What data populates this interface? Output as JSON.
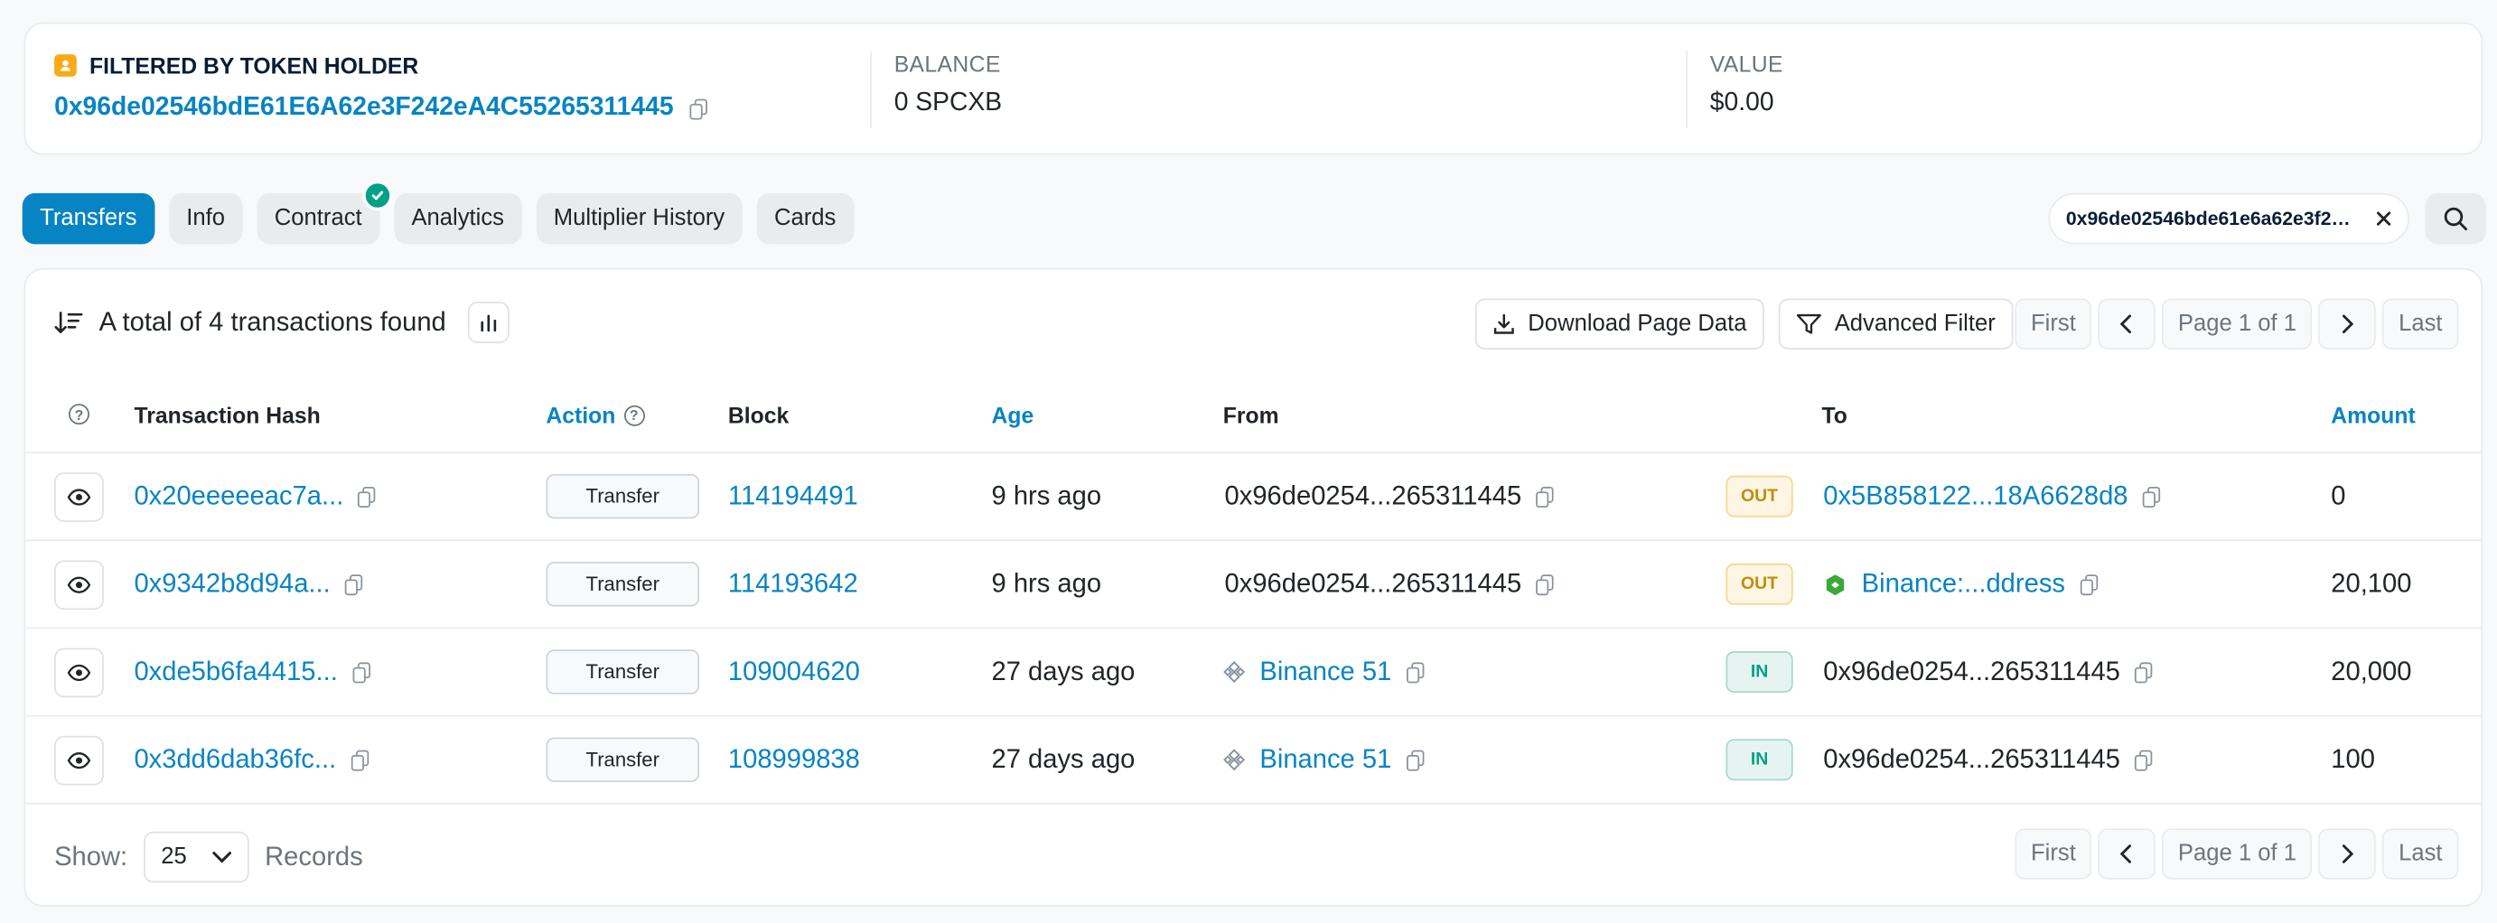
{
  "holder": {
    "title": "FILTERED BY TOKEN HOLDER",
    "address": "0x96de02546bdE61E6A62e3F242eA4C55265311445",
    "balance_label": "BALANCE",
    "balance_value": "0 SPCXB",
    "value_label": "VALUE",
    "value_value": "$0.00"
  },
  "tabs": [
    {
      "label": "Transfers",
      "active": true
    },
    {
      "label": "Info"
    },
    {
      "label": "Contract",
      "verified": true
    },
    {
      "label": "Analytics"
    },
    {
      "label": "Multiplier History"
    },
    {
      "label": "Cards"
    }
  ],
  "filter_chip": "0x96de02546bde61e6a62e3f242ea4c55265311445",
  "summary": "A total of 4 transactions found",
  "actions": {
    "download": "Download Page Data",
    "advanced_filter": "Advanced Filter"
  },
  "pager": {
    "first": "First",
    "page": "Page 1 of 1",
    "last": "Last"
  },
  "columns": {
    "hash": "Transaction Hash",
    "action": "Action",
    "block": "Block",
    "age": "Age",
    "from": "From",
    "to": "To",
    "amount": "Amount"
  },
  "rows": [
    {
      "hash": "0x20eeeeeac7a...",
      "method": "Transfer",
      "block": "114194491",
      "age": "9 hrs ago",
      "from": "0x96de0254...265311445",
      "from_link": false,
      "dir": "OUT",
      "to": "0x5B858122...18A6628d8",
      "to_link": true,
      "to_icon": "",
      "amount": "0"
    },
    {
      "hash": "0x9342b8d94a...",
      "method": "Transfer",
      "block": "114193642",
      "age": "9 hrs ago",
      "from": "0x96de0254...265311445",
      "from_link": false,
      "dir": "OUT",
      "to": "Binance:...ddress",
      "to_link": true,
      "to_icon": "binance-contract-icon",
      "amount": "20,100"
    },
    {
      "hash": "0xde5b6fa4415...",
      "method": "Transfer",
      "block": "109004620",
      "age": "27 days ago",
      "from": "Binance 51",
      "from_link": true,
      "dir": "IN",
      "to": "0x96de0254...265311445",
      "to_link": false,
      "to_icon": "",
      "amount": "20,000"
    },
    {
      "hash": "0x3dd6dab36fc...",
      "method": "Transfer",
      "block": "108999838",
      "age": "27 days ago",
      "from": "Binance 51",
      "from_link": true,
      "dir": "IN",
      "to": "0x96de0254...265311445",
      "to_link": false,
      "to_icon": "",
      "amount": "100"
    }
  ],
  "footer": {
    "show": "Show:",
    "per_page": "25",
    "records": "Records"
  },
  "colors": {
    "accent": "#0784c3",
    "in": "#00a186",
    "out": "#c48c0a"
  }
}
